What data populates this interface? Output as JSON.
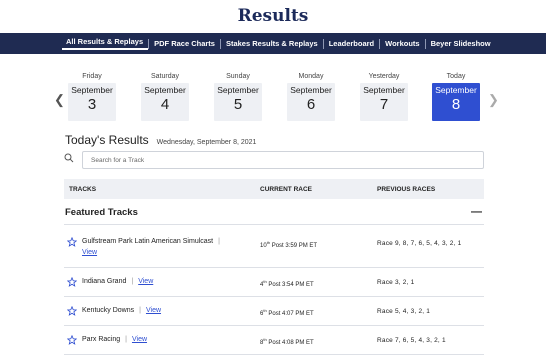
{
  "page": {
    "title": "Results"
  },
  "nav": {
    "items": [
      {
        "label": "All Results & Replays"
      },
      {
        "label": "PDF Race Charts"
      },
      {
        "label": "Stakes Results & Replays"
      },
      {
        "label": "Leaderboard"
      },
      {
        "label": "Workouts"
      },
      {
        "label": "Beyer Slideshow"
      }
    ]
  },
  "dates": [
    {
      "day": "Friday",
      "month": "September",
      "date": "3"
    },
    {
      "day": "Saturday",
      "month": "September",
      "date": "4"
    },
    {
      "day": "Sunday",
      "month": "September",
      "date": "5"
    },
    {
      "day": "Monday",
      "month": "September",
      "date": "6"
    },
    {
      "day": "Yesterday",
      "month": "September",
      "date": "7"
    },
    {
      "day": "Today",
      "month": "September",
      "date": "8"
    }
  ],
  "results": {
    "title": "Today's Results",
    "date": "Wednesday, September 8, 2021"
  },
  "search": {
    "placeholder": "Search for a Track"
  },
  "table": {
    "headers": {
      "tracks": "TRACKS",
      "current": "CURRENT RACE",
      "previous": "PREVIOUS RACES"
    },
    "section": "Featured Tracks",
    "collapse": "—",
    "view_label": "View",
    "rows": [
      {
        "track": "Gulfstream Park Latin American Simulcast",
        "post_num": "10",
        "post_suffix": "th",
        "post_text": " Post 3:59 PM ET",
        "previous": "Race 9, 8, 7, 6, 5, 4, 3, 2, 1"
      },
      {
        "track": "Indiana Grand",
        "post_num": "4",
        "post_suffix": "th",
        "post_text": " Post 3:54 PM ET",
        "previous": "Race 3, 2, 1"
      },
      {
        "track": "Kentucky Downs",
        "post_num": "6",
        "post_suffix": "th",
        "post_text": " Post 4:07 PM ET",
        "previous": "Race 5, 4, 3, 2, 1"
      },
      {
        "track": "Parx Racing",
        "post_num": "8",
        "post_suffix": "th",
        "post_text": " Post 4:08 PM ET",
        "previous": "Race 7, 6, 5, 4, 3, 2, 1"
      }
    ]
  },
  "colors": {
    "nav_bg": "#1f2b52",
    "title": "#1c2a5a",
    "accent": "#2f4fd1"
  }
}
